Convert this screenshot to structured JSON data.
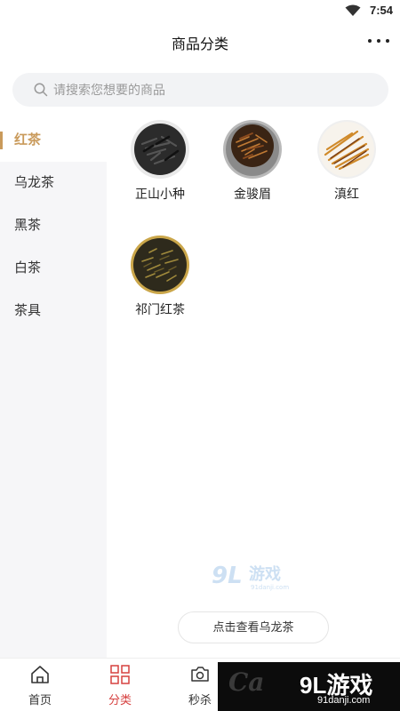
{
  "status_bar": {
    "time": "7:54"
  },
  "header": {
    "title": "商品分类"
  },
  "search": {
    "placeholder": "请搜索您想要的商品"
  },
  "sidebar": {
    "items": [
      {
        "label": "红茶",
        "active": true
      },
      {
        "label": "乌龙茶",
        "active": false
      },
      {
        "label": "黑茶",
        "active": false
      },
      {
        "label": "白茶",
        "active": false
      },
      {
        "label": "茶具",
        "active": false
      }
    ]
  },
  "products": [
    {
      "name": "正山小种"
    },
    {
      "name": "金骏眉"
    },
    {
      "name": "滇红"
    },
    {
      "name": "祁门红茶"
    }
  ],
  "next_category_button": "点击查看乌龙茶",
  "watermark": {
    "brand": "游戏",
    "domain": "91danji.com"
  },
  "tabbar": {
    "items": [
      {
        "label": "首页",
        "icon": "home-icon",
        "active": false
      },
      {
        "label": "分类",
        "icon": "grid-icon",
        "active": true
      },
      {
        "label": "秒杀",
        "icon": "camera-icon",
        "active": false
      }
    ]
  },
  "corner_logo": {
    "brand": "9L游戏",
    "domain": "91danji.com"
  },
  "colors": {
    "accent": "#c99a5b",
    "tab_active": "#d6403f",
    "sidebar_bg": "#f6f6f8",
    "search_bg": "#f2f3f5"
  }
}
